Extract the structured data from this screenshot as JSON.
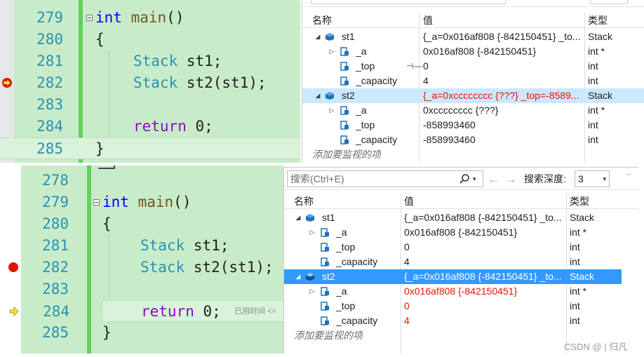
{
  "top": {
    "code_lines": [
      {
        "num": "279"
      },
      {
        "num": "280"
      },
      {
        "num": "281"
      },
      {
        "num": "282"
      },
      {
        "num": "283"
      },
      {
        "num": "284"
      },
      {
        "num": "285"
      }
    ],
    "code": {
      "kw_int": "int",
      "fn_main": "main",
      "parens": "()",
      "brace_open": "{",
      "ty_stack": "Stack",
      "decl_st1": " st1;",
      "decl_st2": " st2(st1);",
      "kw_return": "return",
      "ret_val": " 0;",
      "brace_close": "}"
    },
    "watch": {
      "headers": {
        "name": "名称",
        "value": "值",
        "type": "类型"
      },
      "rows": [
        {
          "name": "st1",
          "value": "{_a=0x016af808 {-842150451} _to...",
          "type": "Stack"
        },
        {
          "name": "_a",
          "value": "0x016af808 {-842150451}",
          "type": "int *"
        },
        {
          "name": "_top",
          "value": "0",
          "type": "int"
        },
        {
          "name": "_capacity",
          "value": "4",
          "type": "int"
        },
        {
          "name": "st2",
          "value": "{_a=0xcccccccc {???} _top=-8589...",
          "type": "Stack"
        },
        {
          "name": "_a",
          "value": "0xcccccccc {???}",
          "type": "int *"
        },
        {
          "name": "_top",
          "value": "-858993460",
          "type": "int"
        },
        {
          "name": "_capacity",
          "value": "-858993460",
          "type": "int"
        }
      ],
      "add_watch": "添加要监视的项"
    }
  },
  "bottom": {
    "code_lines": [
      {
        "num": "278"
      },
      {
        "num": "279"
      },
      {
        "num": "280"
      },
      {
        "num": "281"
      },
      {
        "num": "282"
      },
      {
        "num": "283"
      },
      {
        "num": "284"
      },
      {
        "num": "285"
      }
    ],
    "code": {
      "kw_int": "int",
      "fn_main": "main",
      "parens": "()",
      "brace_open": "{",
      "ty_stack": "Stack",
      "decl_st1": " st1;",
      "decl_st2": " st2(st1);",
      "kw_return": "return",
      "ret_val": " 0;",
      "brace_close": "}",
      "elapsed_hint": "已用时间 <="
    },
    "watch": {
      "search_placeholder": "搜索(Ctrl+E)",
      "search_depth_label": "搜索深度:",
      "search_depth_value": "3",
      "headers": {
        "name": "名称",
        "value": "值",
        "type": "类型"
      },
      "rows": [
        {
          "name": "st1",
          "value": "{_a=0x016af808 {-842150451} _to...",
          "type": "Stack"
        },
        {
          "name": "_a",
          "value": "0x016af808 {-842150451}",
          "type": "int *"
        },
        {
          "name": "_top",
          "value": "0",
          "type": "int"
        },
        {
          "name": "_capacity",
          "value": "4",
          "type": "int"
        },
        {
          "name": "st2",
          "value": "{_a=0x016af808 {-842150451} _to...",
          "type": "Stack"
        },
        {
          "name": "_a",
          "value": "0x016af808 {-842150451}",
          "type": "int *"
        },
        {
          "name": "_top",
          "value": "0",
          "type": "int"
        },
        {
          "name": "_capacity",
          "value": "4",
          "type": "int"
        }
      ],
      "add_watch": "添加要监视的项"
    }
  },
  "watermark": "CSDN @ | 归凡",
  "colors": {
    "editor_bg": "#c8ecc9",
    "line_number": "#2b91af",
    "keyword": "#0000ff",
    "control_keyword": "#8f08c4",
    "changed_value": "#e51400",
    "breakpoint": "#e51400",
    "selection": "#3399ff"
  },
  "icons": [
    "current-statement-arrow-icon",
    "breakpoint-icon",
    "collapse-box-icon",
    "variable-icon",
    "field-icon",
    "search-icon",
    "nav-back-icon",
    "nav-forward-icon",
    "dropdown-chevron-icon"
  ]
}
